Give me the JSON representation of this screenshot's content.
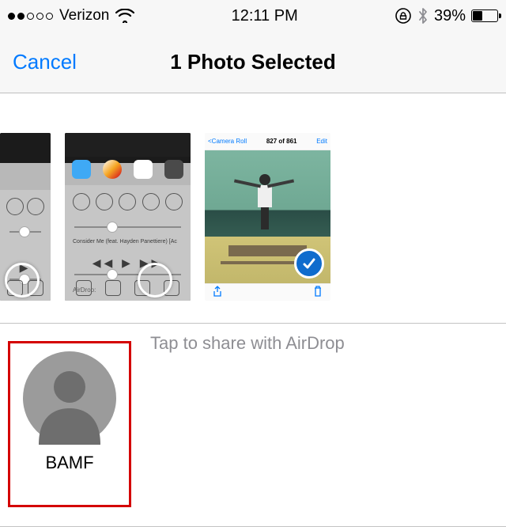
{
  "status": {
    "signal_filled": 2,
    "signal_total": 5,
    "carrier": "Verizon",
    "time": "12:11 PM",
    "battery_pct": "39%"
  },
  "nav": {
    "cancel": "Cancel",
    "title": "1 Photo Selected"
  },
  "thumbs": {
    "photo_counter": "827 of 861",
    "back_label": "Camera Roll",
    "edit_label": "Edit",
    "now_playing": "Consider Me (feat. Hayden Panettiere) [Ac",
    "media_controls": "◀◀  ▶  ▶▶",
    "airdrop_label": "AirDrop:"
  },
  "airdrop": {
    "hint": "Tap to share with AirDrop",
    "contact_name": "BAMF"
  }
}
